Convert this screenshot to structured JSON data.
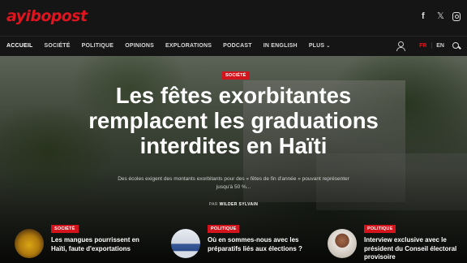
{
  "header": {
    "logo": "ayibopost",
    "social": [
      "facebook-icon",
      "x-icon",
      "instagram-icon"
    ]
  },
  "nav": {
    "items": [
      "ACCUEIL",
      "SOCIÉTÉ",
      "POLITIQUE",
      "OPINIONS",
      "EXPLORATIONS",
      "PODCAST",
      "IN ENGLISH",
      "PLUS"
    ],
    "active": "ACCUEIL",
    "lang_fr": "FR",
    "lang_sep": "|",
    "lang_en": "EN"
  },
  "hero": {
    "category": "SOCIÉTÉ",
    "title": "Les fêtes exorbitantes remplacent les graduations interdites en Haïti",
    "subtitle": "Des écoles exigent des montants exorbitants pour des « fêtes de fin d'année » pouvant représenter jusqu'à 50 %...",
    "author_prefix": "PAR",
    "author": "WILDER SYLVAIN"
  },
  "cards": [
    {
      "category": "SOCIÉTÉ",
      "title": "Les mangues pourrissent en Haïti, faute d'exportations"
    },
    {
      "category": "POLITIQUE",
      "title": "Où en sommes-nous avec les préparatifs liés aux élections ?"
    },
    {
      "category": "POLITIQUE",
      "title": "Interview exclusive avec le président du Conseil électoral provisoire"
    }
  ],
  "colors": {
    "brand": "#e0141e",
    "badge": "#d3141c",
    "background": "#141414"
  }
}
